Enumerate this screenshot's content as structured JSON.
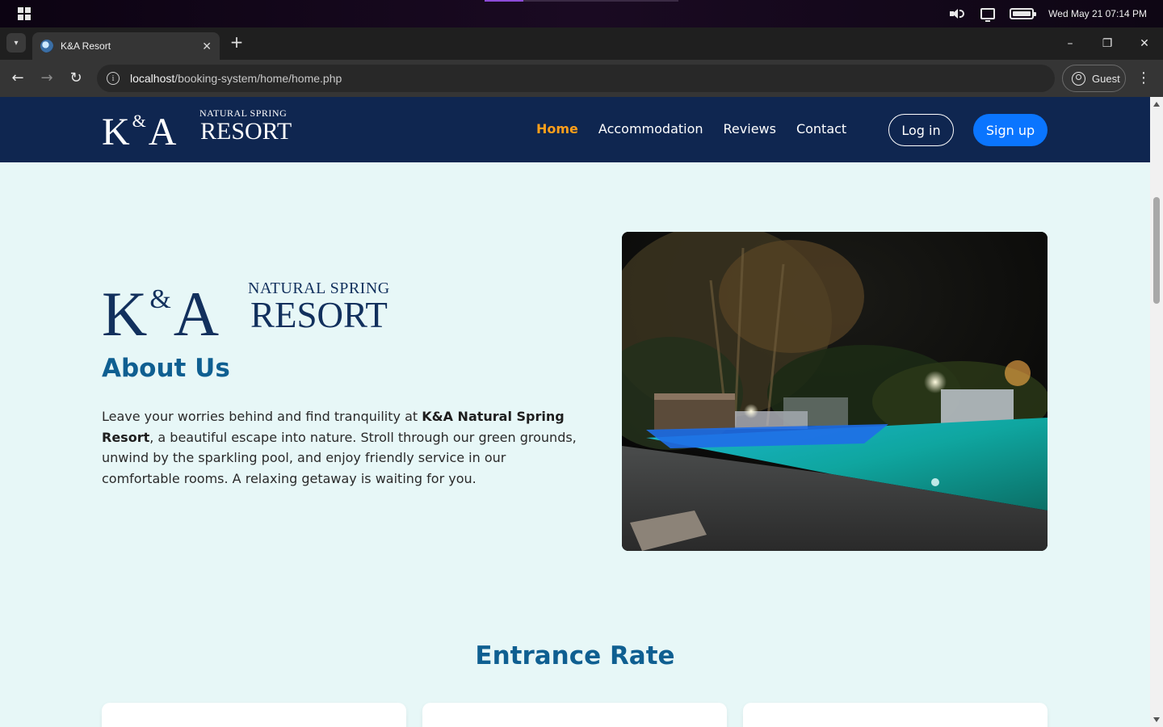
{
  "os": {
    "datetime": "Wed May 21  07:14 PM",
    "icons": [
      "windows-logo-icon",
      "speaker-icon",
      "display-icon",
      "battery-icon"
    ]
  },
  "browser": {
    "tab_title": "K&A Resort",
    "tab_close": "✕",
    "new_tab": "+",
    "url_host": "localhost",
    "url_path": "/booking-system/home/home.php",
    "profile_label": "Guest",
    "window_controls": {
      "minimize": "–",
      "restore": "❐",
      "close": "✕"
    },
    "nav": {
      "back": "←",
      "forward": "→",
      "reload": "↻",
      "menu": "⋮",
      "tab_list": "▾"
    }
  },
  "header": {
    "logo": {
      "ka_k": "K",
      "ka_amp": "&",
      "ka_a": "A",
      "natural_spring": "NATURAL SPRING",
      "resort": "RESORT"
    },
    "nav": [
      "Home",
      "Accommodation",
      "Reviews",
      "Contact"
    ],
    "active_nav": "Home",
    "login_label": "Log in",
    "signup_label": "Sign up"
  },
  "about": {
    "logo": {
      "ka_k": "K",
      "ka_amp": "&",
      "ka_a": "A",
      "natural_spring": "NATURAL SPRING",
      "resort": "RESORT"
    },
    "title": "About Us",
    "text_before": "Leave your worries behind and find tranquility at ",
    "text_bold": "K&A Natural Spring Resort",
    "text_after": ", a beautiful escape into nature. Stroll through our green grounds, unwind by the sparkling pool, and enjoy friendly service in our comfortable rooms. A relaxing getaway is waiting for you."
  },
  "entrance": {
    "title": "Entrance Rate"
  },
  "colors": {
    "header_bg": "#0f2650",
    "page_bg": "#e7f7f7",
    "accent_orange": "#ff9f1a",
    "signup_blue": "#0a75ff",
    "heading_blue": "#0f5f91"
  }
}
